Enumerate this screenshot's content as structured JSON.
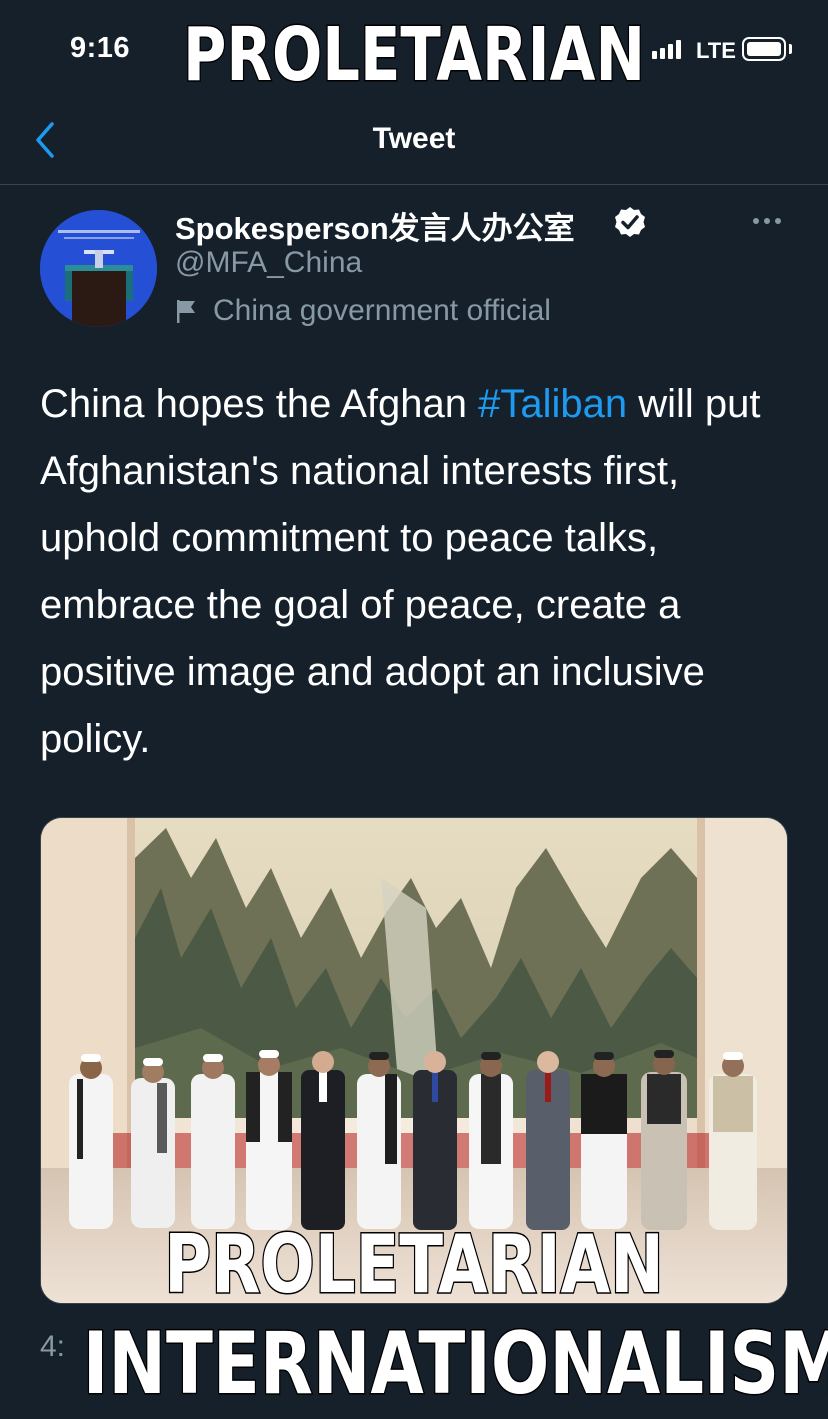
{
  "status_bar": {
    "time": "9:16",
    "network": "LTE"
  },
  "meme": {
    "top_text": "PROLETARIAN",
    "bottom_line_1": "PROLETARIAN",
    "bottom_line_2": "INTERNATIONALISM"
  },
  "nav": {
    "back_icon": "chevron-left-icon",
    "title": "Tweet"
  },
  "tweet": {
    "author": {
      "name": "Spokesperson发言人办公室",
      "handle": "@MFA_China",
      "label": "China government official",
      "verified": true
    },
    "text_before": "China hopes the Afghan ",
    "hashtag": "#Taliban",
    "text_after": " will put Afghanistan's national interests first, uphold commitment to peace talks, embrace the goal of peace, create a positive image and adopt an inclusive policy.",
    "timestamp_partial": "4:"
  },
  "colors": {
    "background": "#15202b",
    "accent": "#1d9bf0",
    "secondary_text": "#8899a6",
    "divider": "#38444d"
  }
}
